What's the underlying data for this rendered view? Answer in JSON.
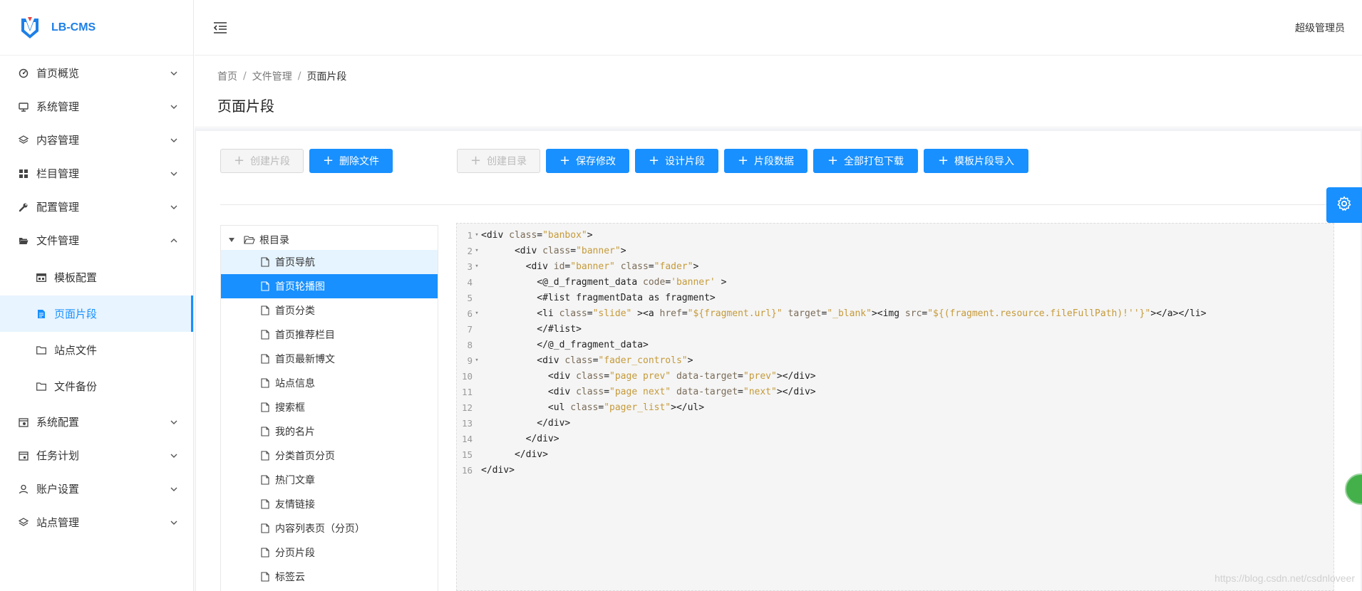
{
  "app": {
    "name": "LB-CMS"
  },
  "header": {
    "user": "超级管理员"
  },
  "sidebar": {
    "items": [
      {
        "label": "首页概览",
        "icon": "dashboard-icon",
        "expanded": false
      },
      {
        "label": "系统管理",
        "icon": "monitor-icon",
        "expanded": false
      },
      {
        "label": "内容管理",
        "icon": "layers-icon",
        "expanded": false
      },
      {
        "label": "栏目管理",
        "icon": "grid-icon",
        "expanded": false
      },
      {
        "label": "配置管理",
        "icon": "wrench-icon",
        "expanded": false
      },
      {
        "label": "文件管理",
        "icon": "folder-open-icon",
        "expanded": true
      },
      {
        "label": "系统配置",
        "icon": "calendar-gear-icon",
        "expanded": false
      },
      {
        "label": "任务计划",
        "icon": "calendar-check-icon",
        "expanded": false
      },
      {
        "label": "账户设置",
        "icon": "user-icon",
        "expanded": false
      },
      {
        "label": "站点管理",
        "icon": "layers-icon",
        "expanded": false
      }
    ],
    "file_submenu": [
      {
        "label": "模板配置",
        "icon": "template-icon"
      },
      {
        "label": "页面片段",
        "icon": "file-text-icon",
        "active": true
      },
      {
        "label": "站点文件",
        "icon": "folder-icon"
      },
      {
        "label": "文件备份",
        "icon": "folder-icon"
      }
    ]
  },
  "breadcrumb": [
    "首页",
    "文件管理",
    "页面片段"
  ],
  "page": {
    "title": "页面片段"
  },
  "toolbar": {
    "create_fragment": "创建片段",
    "delete_file": "删除文件",
    "create_dir": "创建目录",
    "save": "保存修改",
    "design": "设计片段",
    "data": "片段数据",
    "download_all": "全部打包下载",
    "import": "模板片段导入"
  },
  "tree": {
    "root": "根目录",
    "nodes": [
      {
        "label": "首页导航",
        "state": "hover"
      },
      {
        "label": "首页轮播图",
        "state": "selected"
      },
      {
        "label": "首页分类"
      },
      {
        "label": "首页推荐栏目"
      },
      {
        "label": "首页最新博文"
      },
      {
        "label": "站点信息"
      },
      {
        "label": "搜索框"
      },
      {
        "label": "我的名片"
      },
      {
        "label": "分类首页分页"
      },
      {
        "label": "热门文章"
      },
      {
        "label": "友情链接"
      },
      {
        "label": "内容列表页（分页）"
      },
      {
        "label": "分页片段"
      },
      {
        "label": "标签云"
      }
    ]
  },
  "editor": {
    "lines": [
      {
        "n": "1",
        "fold": true,
        "indent": "",
        "tokens": [
          [
            "tag",
            "<div "
          ],
          [
            "attr",
            "class"
          ],
          [
            "tag",
            "="
          ],
          [
            "str",
            "\"banbox\""
          ],
          [
            "tag",
            ">"
          ]
        ]
      },
      {
        "n": "2",
        "fold": true,
        "indent": "      ",
        "tokens": [
          [
            "tag",
            "<div "
          ],
          [
            "attr",
            "class"
          ],
          [
            "tag",
            "="
          ],
          [
            "str",
            "\"banner\""
          ],
          [
            "tag",
            ">"
          ]
        ]
      },
      {
        "n": "3",
        "fold": true,
        "indent": "        ",
        "tokens": [
          [
            "tag",
            "<div "
          ],
          [
            "attr",
            "id"
          ],
          [
            "tag",
            "="
          ],
          [
            "str",
            "\"banner\""
          ],
          [
            "tag",
            " "
          ],
          [
            "attr",
            "class"
          ],
          [
            "tag",
            "="
          ],
          [
            "str",
            "\"fader\""
          ],
          [
            "tag",
            ">"
          ]
        ]
      },
      {
        "n": "4",
        "fold": false,
        "indent": "          ",
        "tokens": [
          [
            "tag",
            "<@_d_fragment_data "
          ],
          [
            "attr",
            "code"
          ],
          [
            "tag",
            "="
          ],
          [
            "str",
            "'banner'"
          ],
          [
            "tag",
            " >"
          ]
        ]
      },
      {
        "n": "5",
        "fold": false,
        "indent": "          ",
        "tokens": [
          [
            "tag",
            "<#list fragmentData as fragment>"
          ]
        ]
      },
      {
        "n": "6",
        "fold": true,
        "indent": "          ",
        "tokens": [
          [
            "tag",
            "<li "
          ],
          [
            "attr",
            "class"
          ],
          [
            "tag",
            "="
          ],
          [
            "str",
            "\"slide\""
          ],
          [
            "tag",
            " ><a "
          ],
          [
            "attr",
            "href"
          ],
          [
            "tag",
            "="
          ],
          [
            "str",
            "\"${fragment.url}\""
          ],
          [
            "tag",
            " "
          ],
          [
            "attr",
            "target"
          ],
          [
            "tag",
            "="
          ],
          [
            "str",
            "\"_blank\""
          ],
          [
            "tag",
            "><img "
          ],
          [
            "attr",
            "src"
          ],
          [
            "tag",
            "="
          ],
          [
            "str",
            "\"${(fragment.resource.fileFullPath)!''}\""
          ],
          [
            "tag",
            "></a></li>"
          ]
        ]
      },
      {
        "n": "7",
        "fold": false,
        "indent": "          ",
        "tokens": [
          [
            "tag",
            "</#list>"
          ]
        ]
      },
      {
        "n": "8",
        "fold": false,
        "indent": "          ",
        "tokens": [
          [
            "tag",
            "</@_d_fragment_data>"
          ]
        ]
      },
      {
        "n": "9",
        "fold": true,
        "indent": "          ",
        "tokens": [
          [
            "tag",
            "<div "
          ],
          [
            "attr",
            "class"
          ],
          [
            "tag",
            "="
          ],
          [
            "str",
            "\"fader_controls\""
          ],
          [
            "tag",
            ">"
          ]
        ]
      },
      {
        "n": "10",
        "fold": false,
        "indent": "            ",
        "tokens": [
          [
            "tag",
            "<div "
          ],
          [
            "attr",
            "class"
          ],
          [
            "tag",
            "="
          ],
          [
            "str",
            "\"page prev\""
          ],
          [
            "tag",
            " "
          ],
          [
            "attr",
            "data-target"
          ],
          [
            "tag",
            "="
          ],
          [
            "str",
            "\"prev\""
          ],
          [
            "tag",
            "></div>"
          ]
        ]
      },
      {
        "n": "11",
        "fold": false,
        "indent": "            ",
        "tokens": [
          [
            "tag",
            "<div "
          ],
          [
            "attr",
            "class"
          ],
          [
            "tag",
            "="
          ],
          [
            "str",
            "\"page next\""
          ],
          [
            "tag",
            " "
          ],
          [
            "attr",
            "data-target"
          ],
          [
            "tag",
            "="
          ],
          [
            "str",
            "\"next\""
          ],
          [
            "tag",
            "></div>"
          ]
        ]
      },
      {
        "n": "12",
        "fold": false,
        "indent": "            ",
        "tokens": [
          [
            "tag",
            "<ul "
          ],
          [
            "attr",
            "class"
          ],
          [
            "tag",
            "="
          ],
          [
            "str",
            "\"pager_list\""
          ],
          [
            "tag",
            "></ul>"
          ]
        ]
      },
      {
        "n": "13",
        "fold": false,
        "indent": "          ",
        "tokens": [
          [
            "tag",
            "</div>"
          ]
        ]
      },
      {
        "n": "14",
        "fold": false,
        "indent": "        ",
        "tokens": [
          [
            "tag",
            "</div>"
          ]
        ]
      },
      {
        "n": "15",
        "fold": false,
        "indent": "      ",
        "tokens": [
          [
            "tag",
            "</div>"
          ]
        ]
      },
      {
        "n": "16",
        "fold": false,
        "indent": "",
        "tokens": [
          [
            "tag",
            "</div>"
          ]
        ]
      }
    ]
  },
  "watermark": "https://blog.csdn.net/csdnloveer",
  "colors": {
    "primary": "#1890ff",
    "active_bg": "#e8f4ff"
  }
}
